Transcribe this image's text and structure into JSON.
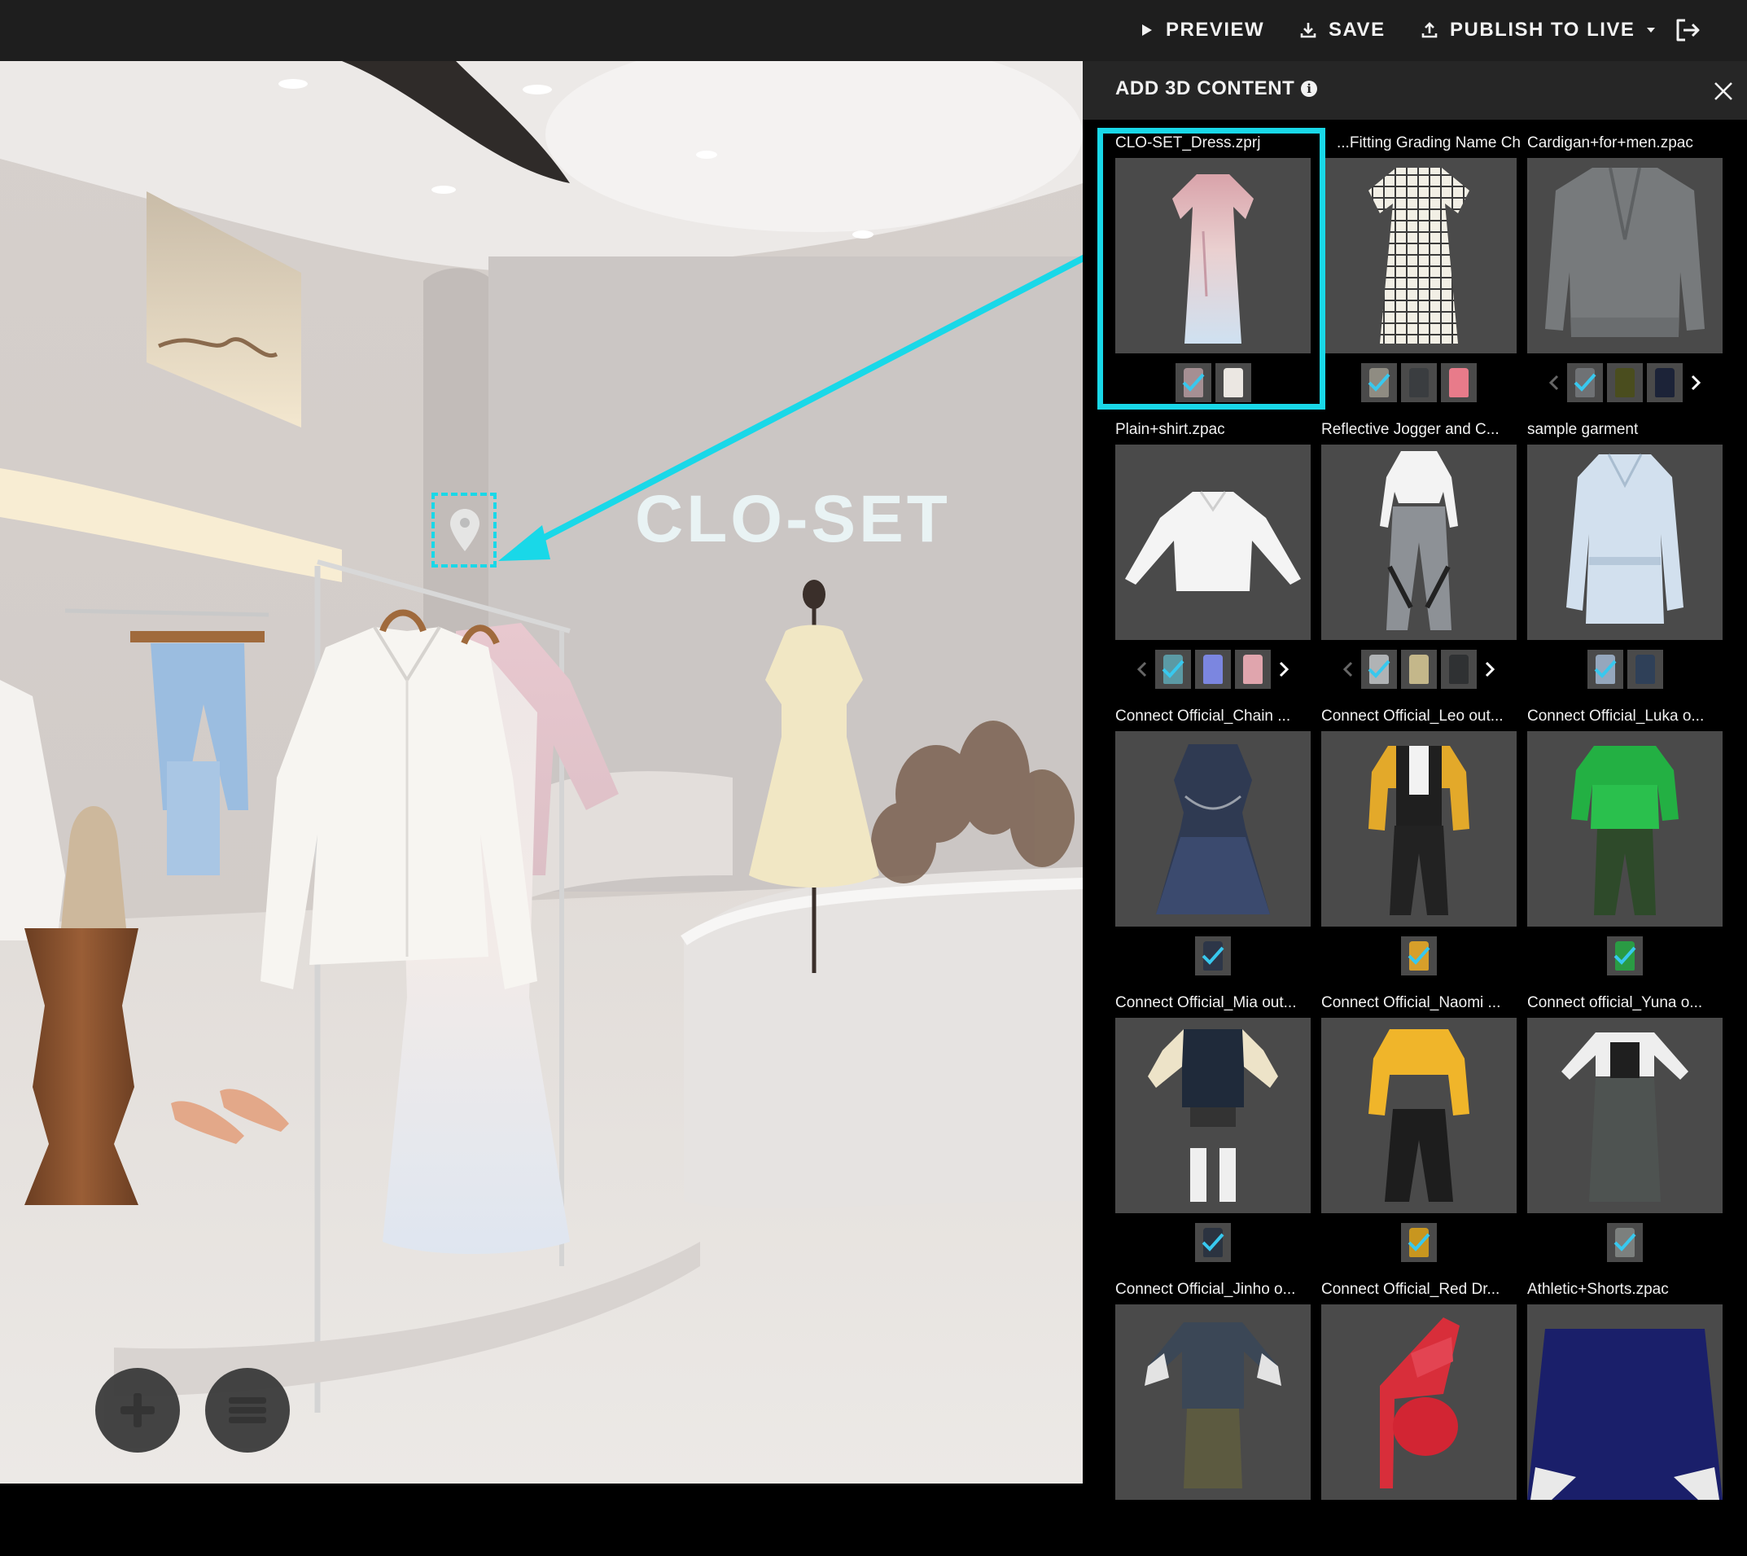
{
  "topbar": {
    "preview_label": "PREVIEW",
    "save_label": "SAVE",
    "publish_label": "PUBLISH TO LIVE",
    "preview_icon": "play-icon",
    "save_icon": "download-icon",
    "publish_icon": "upload-icon",
    "exit_icon": "logout-icon"
  },
  "viewport": {
    "wall_sign": "CLO-SET",
    "add_icon": "plus-icon",
    "list_icon": "menu-icon",
    "hotspot_icon": "location-pin-icon"
  },
  "panel": {
    "title": "ADD 3D CONTENT",
    "info_icon": "info-icon",
    "close_icon": "close-icon",
    "items": [
      {
        "title": "CLO-SET_Dress.zprj",
        "selected": true
      },
      {
        "title": "Fitting Grading Name Ch..."
      },
      {
        "title": "Cardigan+for+men.zpac"
      },
      {
        "title": "Plain+shirt.zpac"
      },
      {
        "title": "Reflective Jogger and C..."
      },
      {
        "title": "sample garment"
      },
      {
        "title": "Connect Official_Chain ..."
      },
      {
        "title": "Connect Official_Leo out..."
      },
      {
        "title": "Connect Official_Luka o..."
      },
      {
        "title": "Connect Official_Mia out..."
      },
      {
        "title": "Connect Official_Naomi ..."
      },
      {
        "title": "Connect official_Yuna o..."
      },
      {
        "title": "Connect Official_Jinho o..."
      },
      {
        "title": "Connect Official_Red Dr..."
      },
      {
        "title": "Athletic+Shorts.zpac"
      }
    ]
  },
  "colors": {
    "accent": "#19d8e8",
    "check": "#38c8ee",
    "panel_bg": "#000000",
    "header_bg": "#262626",
    "thumb_bg": "#4a4a4a"
  }
}
